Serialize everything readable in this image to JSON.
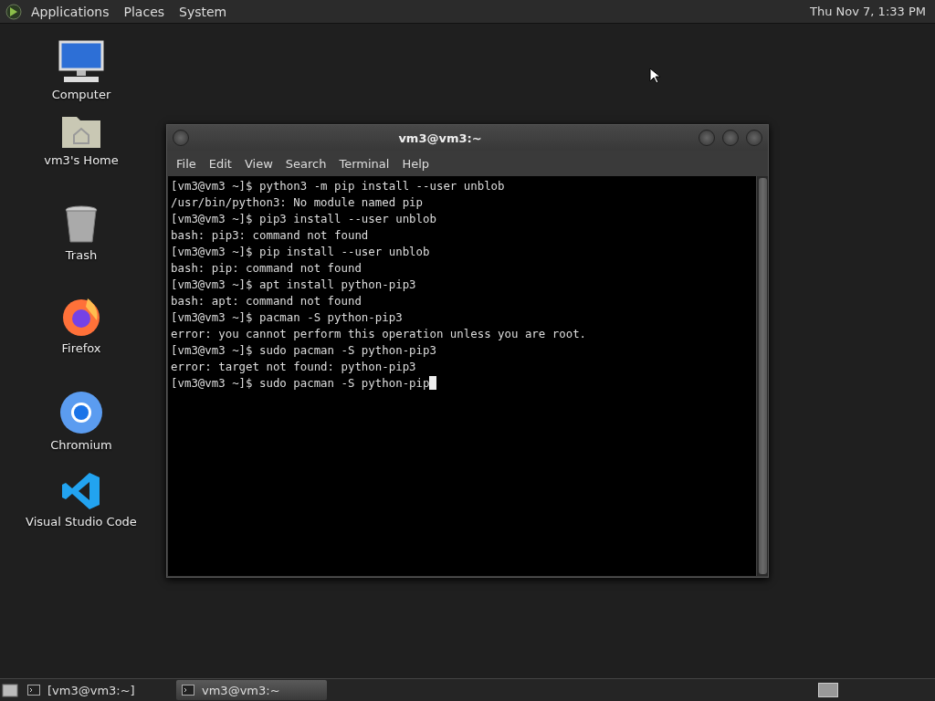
{
  "top_panel": {
    "menus": [
      "Applications",
      "Places",
      "System"
    ],
    "clock": "Thu Nov 7, 1:33 PM"
  },
  "desktop_icons": [
    {
      "kind": "computer",
      "label": "Computer"
    },
    {
      "kind": "home",
      "label": "vm3's Home"
    },
    {
      "kind": "trash",
      "label": "Trash"
    },
    {
      "kind": "firefox",
      "label": "Firefox"
    },
    {
      "kind": "chromium",
      "label": "Chromium"
    },
    {
      "kind": "vscode",
      "label": "Visual Studio Code"
    }
  ],
  "window": {
    "title": "vm3@vm3:~",
    "menus": [
      "File",
      "Edit",
      "View",
      "Search",
      "Terminal",
      "Help"
    ],
    "lines": [
      "[vm3@vm3 ~]$ python3 -m pip install --user unblob",
      "/usr/bin/python3: No module named pip",
      "[vm3@vm3 ~]$ pip3 install --user unblob",
      "bash: pip3: command not found",
      "[vm3@vm3 ~]$ pip install --user unblob",
      "bash: pip: command not found",
      "[vm3@vm3 ~]$ apt install python-pip3",
      "bash: apt: command not found",
      "[vm3@vm3 ~]$ pacman -S python-pip3",
      "error: you cannot perform this operation unless you are root.",
      "[vm3@vm3 ~]$ sudo pacman -S python-pip3",
      "error: target not found: python-pip3",
      "[vm3@vm3 ~]$ sudo pacman -S python-pip"
    ],
    "cursor": true
  },
  "taskbar": {
    "tasks": [
      {
        "label": "[vm3@vm3:~]",
        "selected": false
      },
      {
        "label": "vm3@vm3:~",
        "selected": true
      }
    ]
  }
}
